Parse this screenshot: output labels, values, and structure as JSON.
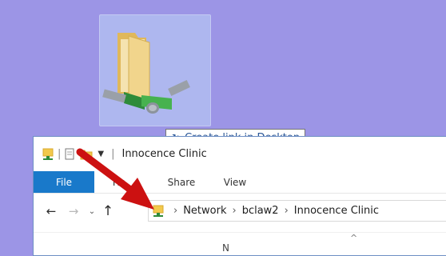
{
  "drag": {
    "icon": "network-folder-shortcut-icon",
    "tooltip_icon": "link-arrow-icon",
    "tooltip": "Create link in Desktop"
  },
  "window": {
    "quick_access": [
      "network-folder-icon",
      "properties-icon",
      "new-folder-icon",
      "customize-dropdown-icon"
    ],
    "title": "Innocence Clinic",
    "ribbon": {
      "file": "File",
      "home": "Ho",
      "share": "Share",
      "view": "View"
    },
    "nav": {
      "back": "←",
      "forward": "→",
      "recent": "⌄",
      "up": "↑"
    },
    "breadcrumb": [
      "Network",
      "bclaw2",
      "Innocence Clinic"
    ],
    "column_header": "N",
    "sort_indicator": "^"
  },
  "colors": {
    "desktop": "#9c95e6",
    "file_tab": "#1979ca",
    "arrow": "#cc1111"
  }
}
